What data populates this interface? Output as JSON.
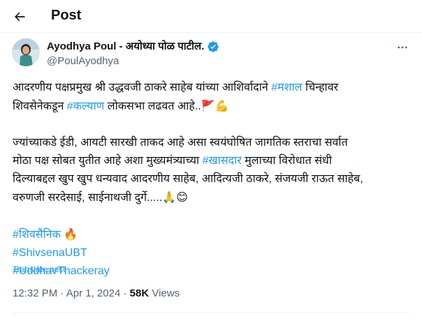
{
  "header": {
    "title": "Post"
  },
  "author": {
    "display_name": "Ayodhya Poul - अयोध्या पोळ पाटील.",
    "handle": "@PoulAyodhya"
  },
  "tweet": {
    "line1_a": "आदरणीय पक्षप्रमुख श्री उद्धवजी ठाकरे साहेब यांच्या आशिर्वादाने ",
    "line1_tag": "#मशाल",
    "line1_b": " चिन्हावर",
    "line2_a": "शिवसेनेकडून ",
    "line2_tag": "#कल्याण",
    "line2_b": " लोकसभा लढवत आहे..",
    "line2_emoji": "🚩💪",
    "line3": "ज्यांच्याकडे ईडी, आयटी सारखी ताकद आहे असा स्वयंघोषित जागतिक स्तराचा सर्वात",
    "line4_a": "मोठा पक्ष सोबत युतीत आहे अशा मुख्यमंत्र्याच्या ",
    "line4_tag": "#खासदार",
    "line4_b": " मुलाच्या विरोधात संधी",
    "line5": "दिल्याबद्दल खुप खुप धन्यवाद आदरणीय साहेब, आदित्यजी ठाकरे, संजयजी राऊत साहेब,",
    "line6": "वरुणजी सरदेसाई, साईनाथजी दुर्गे.....",
    "line6_emoji": "🙏😊",
    "tag1": "#शिवसैनिक",
    "tag1_emoji": "🔥",
    "tag2": "#ShivsenaUBT",
    "tag3": "#UddhavThackeray"
  },
  "translate_label": "Translate post",
  "meta": {
    "time": "12:32 PM",
    "separator": " · ",
    "date": "Apr 1, 2024",
    "views_count": "58K",
    "views_label": " Views"
  },
  "colors": {
    "link": "#1d9bf0",
    "muted": "#536471",
    "text": "#0f1419",
    "verified": "#1d9bf0"
  },
  "icons": {
    "back": "arrow-left-icon",
    "more": "more-horizontal-icon",
    "verified": "verified-badge-icon"
  }
}
